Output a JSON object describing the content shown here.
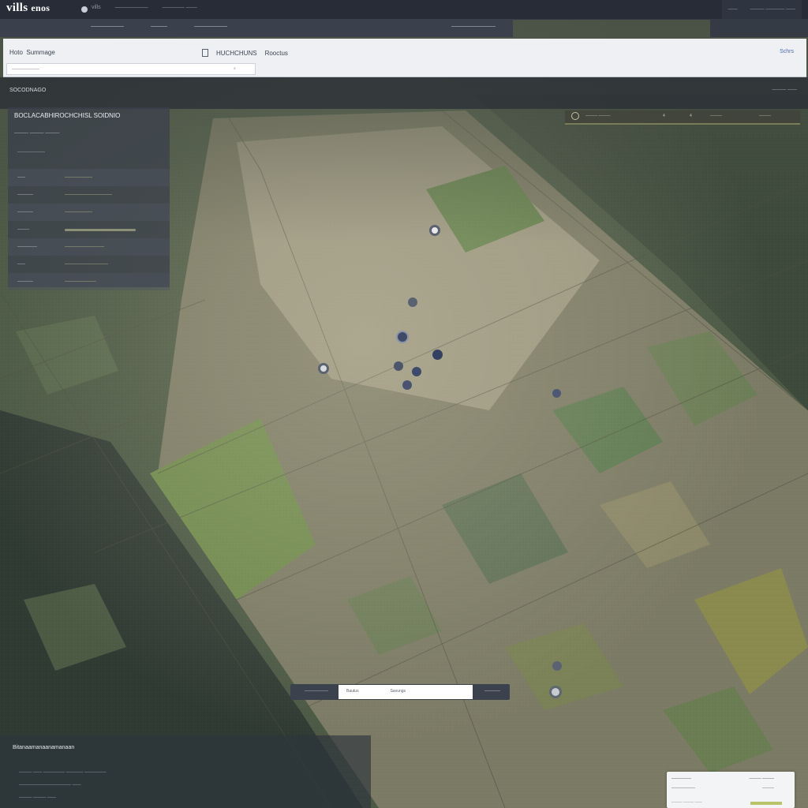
{
  "header": {
    "logo": "vills",
    "logo_suffix": "enos",
    "nav": [
      "vills",
      "——————",
      "———— ——"
    ],
    "right": [
      "——",
      "——— ———— ——"
    ]
  },
  "subtabs": [
    "——————",
    "———",
    "——————",
    "————————"
  ],
  "toolbar": {
    "left_a": "Hoto",
    "left_b": "Summage",
    "mid_a": "HUCHCHUNS",
    "mid_b": "Rooctus",
    "right": "Schrs"
  },
  "search": {
    "placeholder": "———————"
  },
  "strip": {
    "label": "SOCODNAGO",
    "right": "——— ——"
  },
  "panel": {
    "title": "BOCLACABHIROCHCHISL SOIDNIO",
    "subtitle": "——— ——— ———",
    "subhead": "———————",
    "rows": [
      {
        "label": "——",
        "value": "———————"
      },
      {
        "label": "————",
        "value": "————————————"
      },
      {
        "label": "————",
        "value": "———————"
      },
      {
        "label": "———",
        "value": ""
      },
      {
        "label": "—————",
        "value": "——————————"
      },
      {
        "label": "——",
        "value": "———————————"
      },
      {
        "label": "————",
        "value": "————————"
      }
    ]
  },
  "rightbar": {
    "a": "——— ———",
    "b": "4",
    "c": "4",
    "d": "———",
    "e": "———"
  },
  "zoom_bar": {
    "left": "——————",
    "input_a": "Bautus",
    "input_b": "Savungs",
    "right": "————"
  },
  "bottom_panel": {
    "title": "Bitanaamanaanamanaan",
    "lines": [
      "——— —— ————— ———— —————",
      "———————————— ——",
      "——— ——— ——"
    ]
  },
  "card": {
    "title": "—————",
    "value": "——————",
    "right_title": "——— ———",
    "right_value": "———",
    "foot": "——— ——— ——"
  },
  "colors": {
    "accent": "#4d6aa8",
    "panel": "#3a404c",
    "field_green": "#6e8a4c"
  }
}
